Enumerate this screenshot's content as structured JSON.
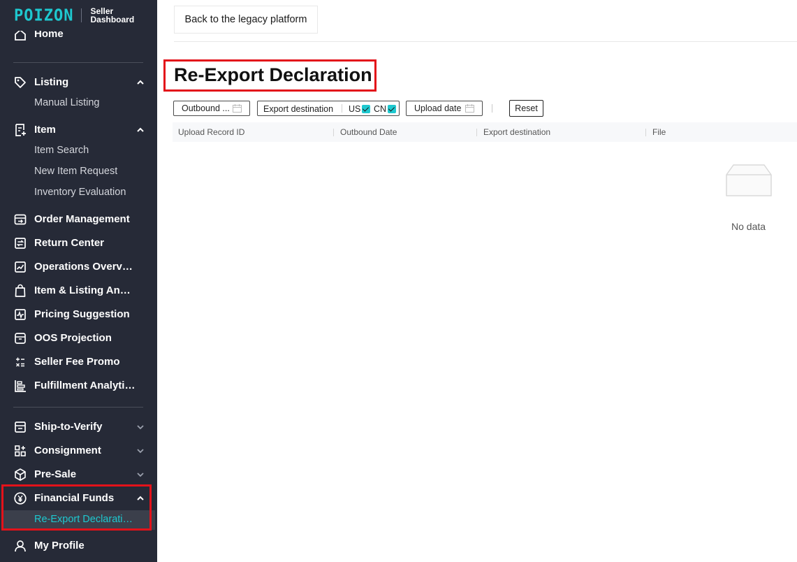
{
  "brand": {
    "logo": "POIZON",
    "subtitle_line1": "Seller",
    "subtitle_line2": "Dashboard"
  },
  "sidebar": {
    "home": "Home",
    "listing": {
      "label": "Listing",
      "children": [
        "Manual Listing"
      ]
    },
    "item": {
      "label": "Item",
      "children": [
        "Item Search",
        "New Item Request",
        "Inventory Evaluation"
      ]
    },
    "items": [
      "Order Management",
      "Return Center",
      "Operations Overview",
      "Item & Listing Analytics",
      "Pricing Suggestion",
      "OOS Projection",
      "Seller Fee Promo",
      "Fulfillment Analytics"
    ],
    "ship_to_verify": "Ship-to-Verify",
    "consignment": "Consignment",
    "pre_sale": "Pre-Sale",
    "financial_funds": {
      "label": "Financial Funds",
      "active_child": "Re-Export Declaration"
    },
    "my_profile": "My Profile"
  },
  "header": {
    "legacy_button": "Back to the legacy platform"
  },
  "page": {
    "title": "Re-Export Declaration"
  },
  "filters": {
    "outbound_placeholder": "Outbound ...",
    "export_destination_label": "Export destination",
    "options": [
      {
        "label": "US",
        "checked": true
      },
      {
        "label": "CN",
        "checked": true
      }
    ],
    "upload_date_placeholder": "Upload date",
    "reset": "Reset"
  },
  "table": {
    "columns": [
      "Upload Record ID",
      "Outbound Date",
      "Export destination",
      "File"
    ],
    "empty_text": "No data"
  },
  "colors": {
    "accent": "#1ec8cf",
    "sidebar_bg": "#262a37",
    "highlight": "#e3121a"
  }
}
